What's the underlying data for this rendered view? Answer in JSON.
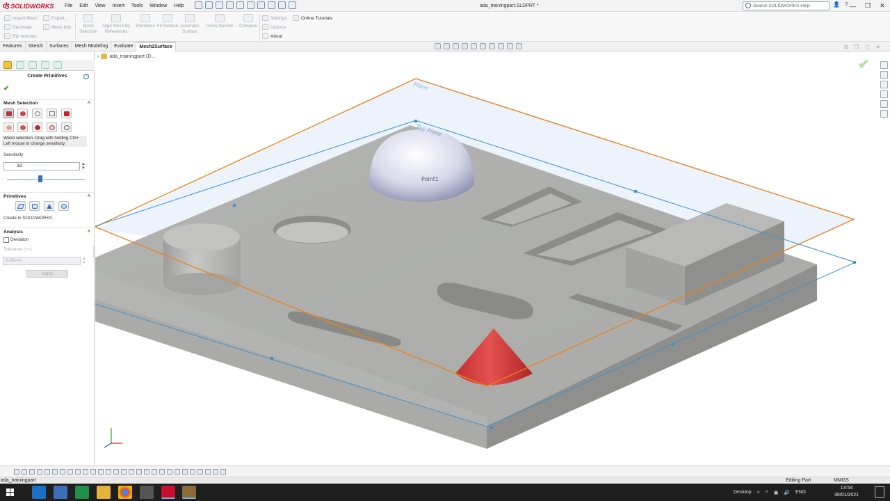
{
  "app": {
    "brand": "SOLIDWORKS",
    "doc_title": "ada_trainingpart.SLDPRT *"
  },
  "menu": [
    "File",
    "Edit",
    "View",
    "Insert",
    "Tools",
    "Window",
    "Help"
  ],
  "search": {
    "placeholder": "Search SOLIDWORKS Help"
  },
  "command_manager": {
    "small": [
      {
        "label": "Import Mesh"
      },
      {
        "label": "Decimate"
      },
      {
        "label": "Rip normals"
      },
      {
        "label": "Export..."
      },
      {
        "label": "Mesh Info"
      }
    ],
    "big": [
      {
        "label": "Mesh Selection"
      },
      {
        "label": "Align Mesh By References"
      },
      {
        "label": "Primitives"
      },
      {
        "label": "Fit Surface"
      },
      {
        "label": "Automatic Surface"
      },
      {
        "label": "Cross-Section"
      },
      {
        "label": "Compare"
      }
    ],
    "right": [
      {
        "label": "Settings"
      },
      {
        "label": "License"
      },
      {
        "label": "About"
      },
      {
        "label": "Online Tutorials"
      }
    ]
  },
  "tabs": [
    {
      "label": "Features"
    },
    {
      "label": "Sketch"
    },
    {
      "label": "Surfaces"
    },
    {
      "label": "Mesh Modeling"
    },
    {
      "label": "Evaluate"
    },
    {
      "label": "Mesh2Surface",
      "active": true
    }
  ],
  "panel": {
    "title": "Create Primitives",
    "mesh_selection": {
      "header": "Mesh Selection",
      "hint": "Wand selection. Drag with holding Ctrl+ Left mouse to change sensitivity.",
      "sensitivity_label": "Sensitivity",
      "sensitivity_value": "33",
      "sensitivity_fraction": 0.33
    },
    "primitives": {
      "header": "Primitives",
      "create_label": "Create in SOLIDWORKS"
    },
    "analysis": {
      "header": "Analysis",
      "deviation_label": "Deviation",
      "tolerance_label": "Tolerance (+/-)",
      "tolerance_value": "0.05mm",
      "apply_label": "Apply"
    }
  },
  "viewport": {
    "tree_item": "ada_trainingpart (D...",
    "labels": {
      "plane": "Plane",
      "top_plane": "Top Plane",
      "point": "Point1"
    }
  },
  "status": {
    "part_name": "ada_trainingpart",
    "mode": "Editing Part",
    "units": "MMGS"
  },
  "taskbar": {
    "desktop_label": "Desktop",
    "lang": "ENG",
    "time": "13:54",
    "date": "30/01/2021"
  },
  "colors": {
    "accent": "#c8102e",
    "plane": "#e87a1c",
    "sketch": "#3a8fd0",
    "cone": "#d43a3a",
    "body": "#b8b9b6"
  }
}
